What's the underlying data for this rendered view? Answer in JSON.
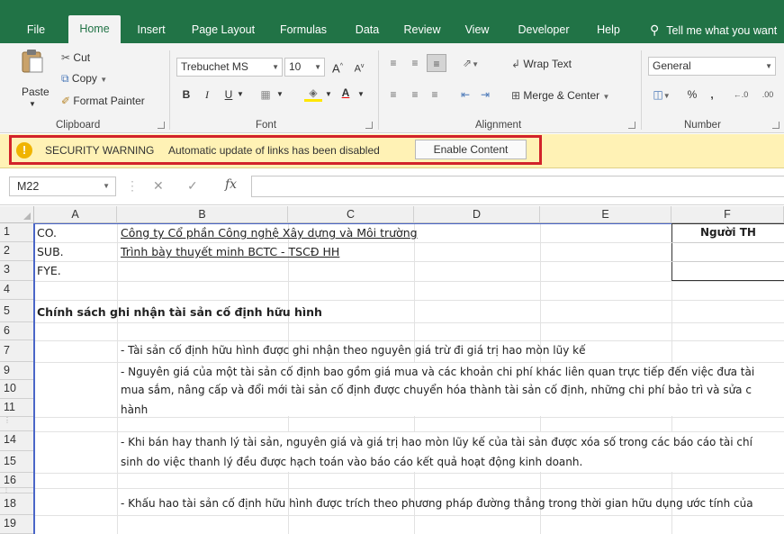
{
  "ribbon_tabs": [
    "File",
    "Home",
    "Insert",
    "Page Layout",
    "Formulas",
    "Data",
    "Review",
    "View",
    "Developer",
    "Help"
  ],
  "tell_me": "Tell me what you want",
  "clipboard": {
    "paste": "Paste",
    "cut": "Cut",
    "copy": "Copy",
    "format_painter": "Format Painter",
    "label": "Clipboard"
  },
  "font": {
    "name": "Trebuchet MS",
    "size": "10",
    "grow": "A",
    "shrink": "A",
    "bold": "B",
    "italic": "I",
    "underline": "U",
    "label": "Font"
  },
  "alignment": {
    "wrap_text": "Wrap Text",
    "merge_center": "Merge & Center",
    "label": "Alignment"
  },
  "number": {
    "format": "General",
    "percent": "%",
    "comma": ",",
    "label": "Number"
  },
  "security": {
    "title": "SECURITY WARNING",
    "message": "Automatic update of links has been disabled",
    "button": "Enable Content"
  },
  "formula_bar": {
    "cell_ref": "M22",
    "fx": "fx"
  },
  "columns": [
    "A",
    "B",
    "C",
    "D",
    "E",
    "F"
  ],
  "rows": [
    "1",
    "2",
    "3",
    "4",
    "5",
    "6",
    "7",
    "9",
    "10",
    "11",
    "14",
    "15",
    "16",
    "18",
    "19"
  ],
  "cells": {
    "a1": "CO.",
    "b1": "Công ty Cổ phần Công nghệ Xây dựng và Môi trường",
    "f1": "Người TH",
    "a2": "SUB.",
    "b2": "Trình bày thuyết minh BCTC - TSCĐ HH",
    "a3": "FYE.",
    "a5": "Chính sách ghi nhận tài sản cố định hữu hình",
    "b7": "- Tài sản cố định hữu hình được ghi nhận theo nguyên giá trừ đi giá trị hao mòn lũy kế",
    "b9": "- Nguyên giá của một tài sản cố định bao gồm giá mua và các khoản chi phí khác liên quan trực tiếp đến việc đưa tài",
    "b10": "mua sắm, nâng cấp và đổi mới tài sản cố định được chuyển hóa thành tài sản cố định, những chi phí bảo trì và sửa c",
    "b11": "hành",
    "b14": "- Khi bán hay thanh lý tài sản, nguyên giá và giá trị hao mòn lũy kế của tài sản được xóa số trong các báo cáo tài chí",
    "b15": "sinh do việc thanh lý đều được hạch toán vào báo cáo kết quả hoạt động kinh doanh.",
    "b18": "- Khấu hao tài sản cố định hữu hình được trích theo phương pháp đường thẳng trong thời gian hữu dụng ước tính của"
  }
}
